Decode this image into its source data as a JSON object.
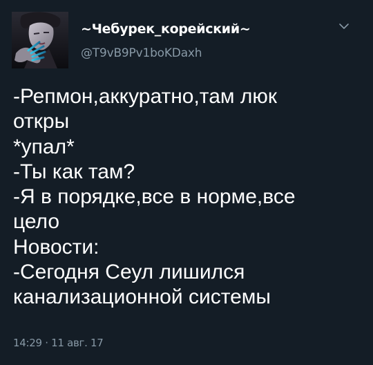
{
  "author": {
    "display_name": "~Чебурек_корейский~",
    "handle": "@T9vB9Pv1boKDaxh"
  },
  "menu": {
    "icon": "chevron-down-icon"
  },
  "tweet": {
    "lines": [
      "-Репмон,аккуратно,там люк",
      "откры",
      "*упал*",
      "-Ты как там?",
      "-Я в порядке,все в норме,все",
      "цело",
      "Новости:",
      "-Сегодня Сеул лишился",
      "канализационной системы"
    ],
    "timestamp": "14:29 · 11 авг. 17"
  },
  "colors": {
    "background": "#141d26",
    "text": "#ffffff",
    "secondary_text": "#8899a6"
  }
}
